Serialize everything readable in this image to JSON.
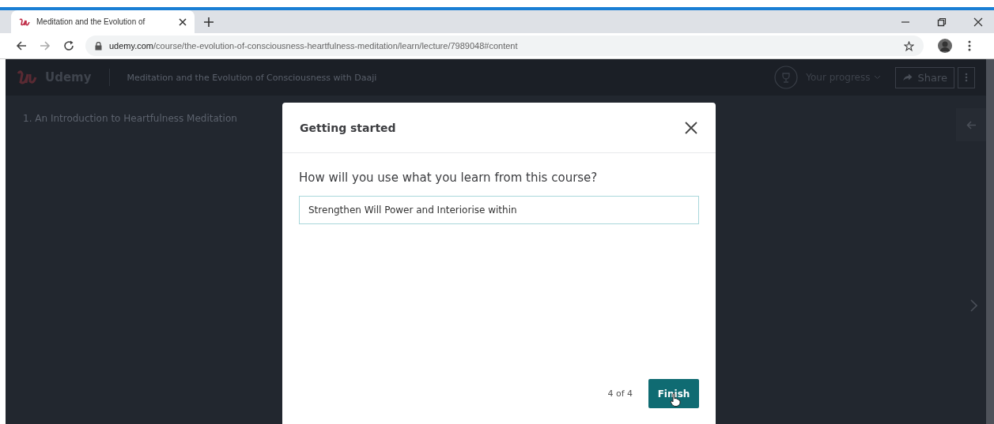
{
  "browser": {
    "tab": {
      "title": "Meditation and the Evolution of",
      "selected": true
    },
    "address": {
      "host": "udemy.com",
      "path": "/course/the-evolution-of-consciousness-heartfulness-meditation/learn/lecture/7989048#content"
    }
  },
  "app": {
    "brand": "Udemy",
    "course_title": "Meditation and the Evolution of Consciousness with Daaji",
    "progress_label": "Your progress",
    "share_label": "Share",
    "lecture_title": "1. An Introduction to Heartfulness Meditation"
  },
  "modal": {
    "title": "Getting started",
    "question": "How will you use what you learn from this course?",
    "answer": "Strengthen Will Power and Interiorise within",
    "step": "4 of 4",
    "finish_label": "Finish"
  }
}
